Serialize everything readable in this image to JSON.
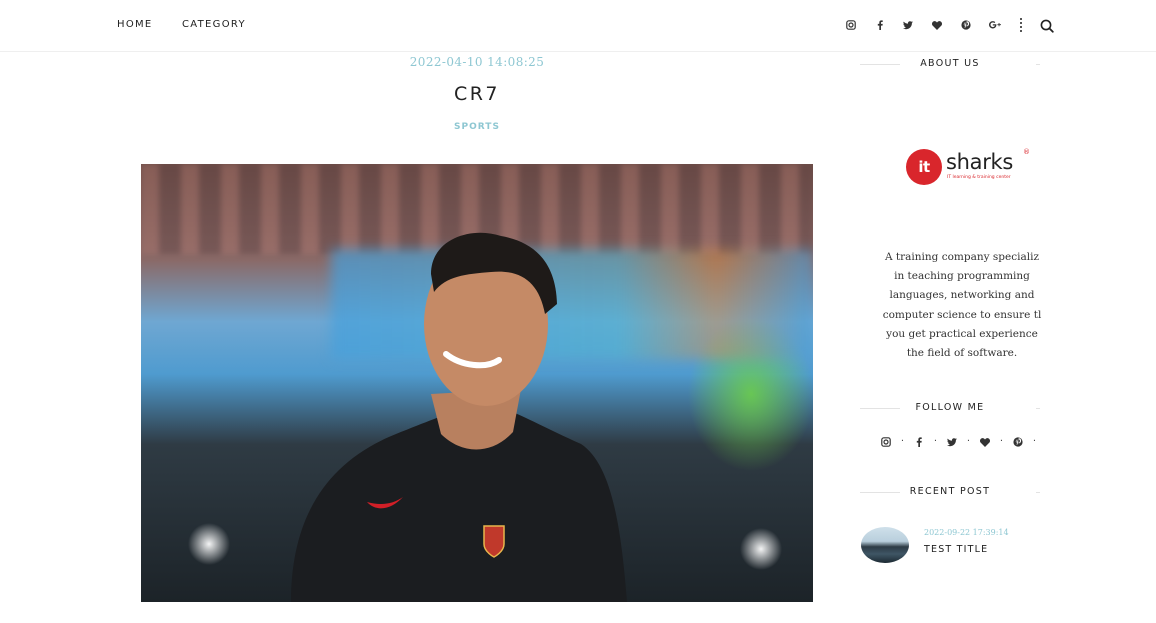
{
  "nav": {
    "home": "HOME",
    "category": "CATEGORY"
  },
  "top_social": [
    "instagram-icon",
    "facebook-icon",
    "twitter-icon",
    "heart-icon",
    "pinterest-icon",
    "google-plus-icon"
  ],
  "post": {
    "date": "2022-04-10 14:08:25",
    "title": "CR7",
    "category": "SPORTS"
  },
  "sidebar": {
    "about_heading": "ABOUT US",
    "logo": {
      "mark": "it",
      "word": "sharks",
      "tagline": "IT learning & training center",
      "reg": "®"
    },
    "about_lines": [
      "A training company specializ",
      "in teaching programming",
      "languages, networking and",
      "computer science to ensure tl",
      "you get practical experience",
      "the field of software."
    ],
    "follow_heading": "FOLLOW ME",
    "recent_heading": "RECENT POST",
    "recent": {
      "date": "2022-09-22 17:39:14",
      "title": "TEST TITLE"
    }
  },
  "colors": {
    "accent": "#8ec7d2",
    "brand_red": "#d9262c",
    "text": "#222222"
  }
}
